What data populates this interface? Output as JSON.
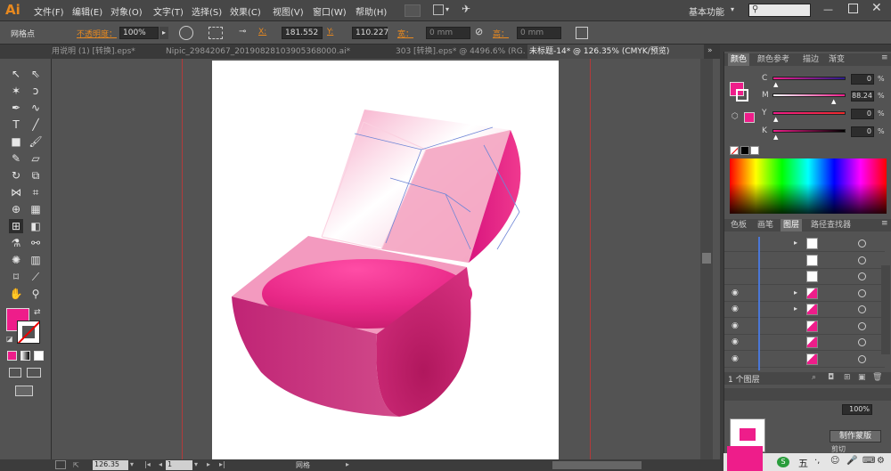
{
  "app": {
    "logo": "Ai"
  },
  "menus": [
    "文件(F)",
    "编辑(E)",
    "对象(O)",
    "文字(T)",
    "选择(S)",
    "效果(C)",
    "视图(V)",
    "窗口(W)",
    "帮助(H)"
  ],
  "workspace": {
    "label": "基本功能",
    "search_placeholder": ""
  },
  "controlbar": {
    "selection_label": "网格点",
    "opacity_label": "不透明度：",
    "opacity_value": "100%",
    "x_label": "X:",
    "x_value": "181.552",
    "y_label": "Y:",
    "y_value": "110.227",
    "w_label": "宽：",
    "w_value": "0 mm",
    "h_label": "高：",
    "h_value": "0 mm"
  },
  "tabs": [
    {
      "label": "用说明 (1) [转换].eps*",
      "active": false
    },
    {
      "label": "Nipic_29842067_20190828103905368000.ai*",
      "active": false
    },
    {
      "label": "303 [转换].eps* @ 4496.6% (RG...",
      "active": false
    },
    {
      "label": "未标题-14* @ 126.35% (CMYK/预览)",
      "active": true
    }
  ],
  "colors": {
    "fill": "#ee1d8a",
    "accent": "#e8891f"
  },
  "color_panel": {
    "tabs": [
      "颜色",
      "颜色参考",
      "描边",
      "渐变"
    ],
    "channels": [
      {
        "name": "C",
        "value": "0",
        "unit": "%",
        "level": 0.0
      },
      {
        "name": "M",
        "value": "88.24",
        "unit": "%",
        "level": 0.8824
      },
      {
        "name": "Y",
        "value": "0",
        "unit": "%",
        "level": 0.0
      },
      {
        "name": "K",
        "value": "0",
        "unit": "%",
        "level": 0.0
      }
    ]
  },
  "layers_panel": {
    "tabs": [
      "色板",
      "画笔",
      "图层",
      "路径查找器"
    ],
    "footer": "1 个图层",
    "rows": [
      {
        "visible": false,
        "expand": true
      },
      {
        "visible": false,
        "expand": false
      },
      {
        "visible": false,
        "expand": false
      },
      {
        "visible": true,
        "expand": true
      },
      {
        "visible": true,
        "expand": true
      },
      {
        "visible": true,
        "expand": false
      },
      {
        "visible": true,
        "expand": false
      },
      {
        "visible": true,
        "expand": false
      }
    ]
  },
  "transparency_panel": {
    "value": "100%",
    "mask_button": "制作蒙版",
    "clip_label": "剪切"
  },
  "statusbar": {
    "zoom": "126.35",
    "artboard": "1",
    "mode": "网格"
  },
  "taskbar": {
    "ime": "五"
  }
}
